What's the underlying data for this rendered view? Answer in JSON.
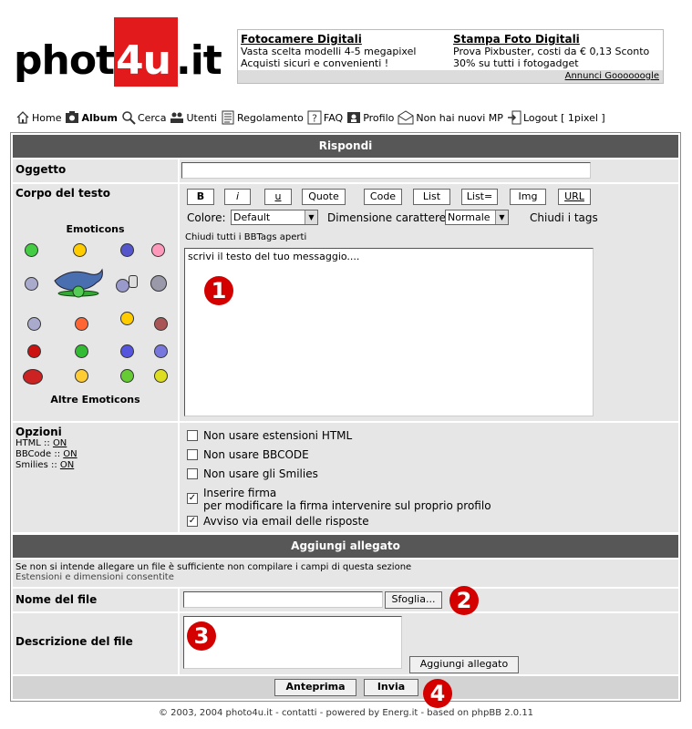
{
  "logo": {
    "text_left": "photo",
    "text_box": "4u",
    "text_right": ".it"
  },
  "ad": {
    "col1_title": "Fotocamere Digitali",
    "col1_line1": "Vasta scelta modelli 4-5 megapixel",
    "col1_line2": "Acquisti sicuri e convenienti !",
    "col2_title": "Stampa Foto Digitali",
    "col2_line1": "Prova Pixbuster, costi da € 0,13 Sconto",
    "col2_line2": "30% su tutti i fotogadget",
    "footer": "Annunci Goooooogle"
  },
  "nav": {
    "home": "Home",
    "album": "Album",
    "search": "Cerca",
    "users": "Utenti",
    "rules": "Regolamento",
    "faq": "FAQ",
    "profile": "Profilo",
    "messages": "Non hai nuovi MP",
    "logout": "Logout [ 1pixel ]"
  },
  "form": {
    "title": "Rispondi",
    "subject_label": "Oggetto",
    "subject_value": "",
    "body_label": "Corpo del testo",
    "toolbar": [
      "B",
      "i",
      "u",
      "Quote",
      "Code",
      "List",
      "List=",
      "Img",
      "URL"
    ],
    "color_label": "Colore:",
    "color_value": "Default",
    "size_label": "Dimensione carattere:",
    "size_value": "Normale",
    "close_tags": "Chiudi i tags",
    "close_all": "Chiudi tutti i BBTags aperti",
    "emoticons_title": "Emoticons",
    "more_emoticons": "Altre Emoticons",
    "message_value": "scrivi il testo del tuo messaggio....",
    "options_label": "Opzioni",
    "html_status": "HTML ::",
    "html_value": "ON",
    "bbcode_status": "BBCode ::",
    "bbcode_value": "ON",
    "smilies_status": "Smilies ::",
    "smilies_value": "ON",
    "opt_html": "Non usare estensioni HTML",
    "opt_bbcode": "Non usare BBCODE",
    "opt_smilies": "Non usare gli Smilies",
    "opt_signature": "Inserire firma",
    "opt_signature_note": "per modificare la firma intervenire sul proprio profilo",
    "opt_notify": "Avviso via email delle risposte"
  },
  "attach": {
    "title": "Aggiungi allegato",
    "note": "Se non si intende allegare un file è sufficiente non compilare i campi di questa sezione",
    "extensions": "Estensioni e dimensioni consentite",
    "filename_label": "Nome del file",
    "browse": "Sfoglia...",
    "description_label": "Descrizione del file",
    "add_button": "Aggiungi allegato"
  },
  "actions": {
    "preview": "Anteprima",
    "submit": "Invia"
  },
  "badges": [
    "1",
    "2",
    "3",
    "4"
  ],
  "footer": {
    "copyright": "© 2003, 2004 photo4u.it - ",
    "contacts": "contatti",
    "powered": " - powered by ",
    "energ": "Energ.it",
    "based": " - based on ",
    "phpbb": "phpBB",
    "version": " 2.0.11"
  },
  "colors": {
    "header_bar": "#575757",
    "cell_bg": "#e6e6e6",
    "badge": "#d40000",
    "logo": "#e31a1c"
  }
}
